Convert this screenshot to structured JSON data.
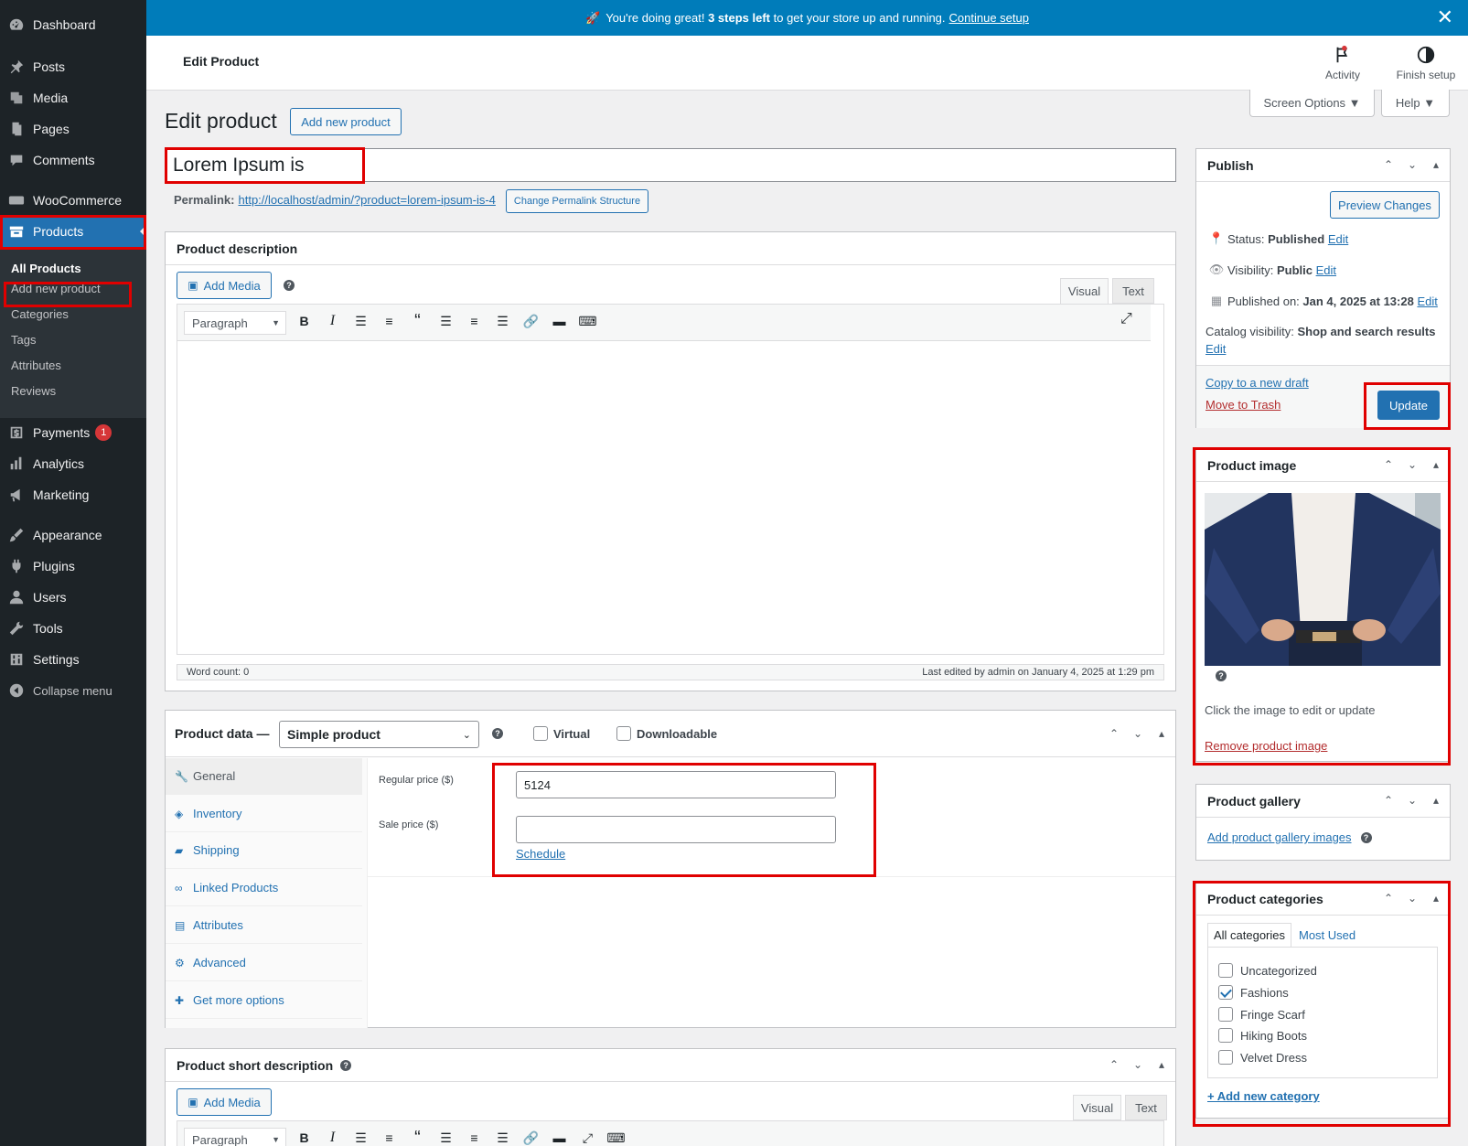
{
  "sidebar": {
    "items": [
      {
        "label": "Dashboard",
        "icon": "dashboard-icon"
      },
      {
        "label": "Posts",
        "icon": "pin-icon"
      },
      {
        "label": "Media",
        "icon": "media-icon"
      },
      {
        "label": "Pages",
        "icon": "pages-icon"
      },
      {
        "label": "Comments",
        "icon": "comment-icon"
      },
      {
        "label": "WooCommerce",
        "icon": "woo-icon"
      },
      {
        "label": "Products",
        "icon": "archive-icon"
      },
      {
        "label": "Payments",
        "icon": "dollar-icon",
        "badge": "1"
      },
      {
        "label": "Analytics",
        "icon": "bar-chart-icon"
      },
      {
        "label": "Marketing",
        "icon": "megaphone-icon"
      },
      {
        "label": "Appearance",
        "icon": "brush-icon"
      },
      {
        "label": "Plugins",
        "icon": "plug-icon"
      },
      {
        "label": "Users",
        "icon": "user-icon"
      },
      {
        "label": "Tools",
        "icon": "wrench-icon"
      },
      {
        "label": "Settings",
        "icon": "settings-icon"
      },
      {
        "label": "Collapse menu",
        "icon": "collapse-icon"
      }
    ],
    "products_sub": [
      "All Products",
      "Add new product",
      "Categories",
      "Tags",
      "Attributes",
      "Reviews"
    ]
  },
  "notice": {
    "emoji": "🚀",
    "pre": "You're doing great!",
    "bold": "3 steps left",
    "post": "to get your store up and running.",
    "link": "Continue setup",
    "close": "✕"
  },
  "header": {
    "title": "Edit Product",
    "activity": "Activity",
    "finish": "Finish setup"
  },
  "screen_options": "Screen Options ▼",
  "help": "Help ▼",
  "page": {
    "heading": "Edit product",
    "add_new": "Add new product"
  },
  "post_title": "Lorem Ipsum is",
  "permalink": {
    "label": "Permalink:",
    "url": "http://localhost/admin/?product=lorem-ipsum-is-4",
    "button": "Change Permalink Structure"
  },
  "description": {
    "title": "Product description",
    "add_media": "Add Media",
    "tab_visual": "Visual",
    "tab_text": "Text",
    "format": "Paragraph",
    "word_count": "Word count: 0",
    "last_edited": "Last edited by admin on January 4, 2025 at 1:29 pm"
  },
  "product_data": {
    "title": "Product data —",
    "type": "Simple product",
    "virtual": "Virtual",
    "downloadable": "Downloadable",
    "tabs": [
      "General",
      "Inventory",
      "Shipping",
      "Linked Products",
      "Attributes",
      "Advanced",
      "Get more options"
    ],
    "regular_label": "Regular price ($)",
    "regular_value": "5124",
    "sale_label": "Sale price ($)",
    "sale_value": "",
    "schedule": "Schedule"
  },
  "short_desc": {
    "title": "Product short description",
    "add_media": "Add Media",
    "tab_visual": "Visual",
    "tab_text": "Text",
    "format": "Paragraph"
  },
  "publish": {
    "title": "Publish",
    "preview": "Preview Changes",
    "status_label": "Status:",
    "status": "Published",
    "visibility_label": "Visibility:",
    "visibility": "Public",
    "published_label": "Published on:",
    "published": "Jan 4, 2025 at 13:28",
    "edit": "Edit",
    "catalog_label": "Catalog visibility:",
    "catalog": "Shop and search results",
    "copy": "Copy to a new draft",
    "trash": "Move to Trash",
    "update": "Update"
  },
  "product_image": {
    "title": "Product image",
    "hint": "Click the image to edit or update",
    "remove": "Remove product image"
  },
  "gallery": {
    "title": "Product gallery",
    "add": "Add product gallery images"
  },
  "categories": {
    "title": "Product categories",
    "tab_all": "All categories",
    "tab_used": "Most Used",
    "add": "+ Add new category",
    "items": [
      {
        "name": "Uncategorized",
        "checked": false
      },
      {
        "name": "Fashions",
        "checked": true
      },
      {
        "name": "Fringe Scarf",
        "checked": false
      },
      {
        "name": "Hiking Boots",
        "checked": false
      },
      {
        "name": "Velvet Dress",
        "checked": false
      }
    ]
  },
  "colors": {
    "sidebar": "#1d2327",
    "accent": "#2271b1",
    "notice": "#007cba",
    "highlight": "#e00000"
  }
}
